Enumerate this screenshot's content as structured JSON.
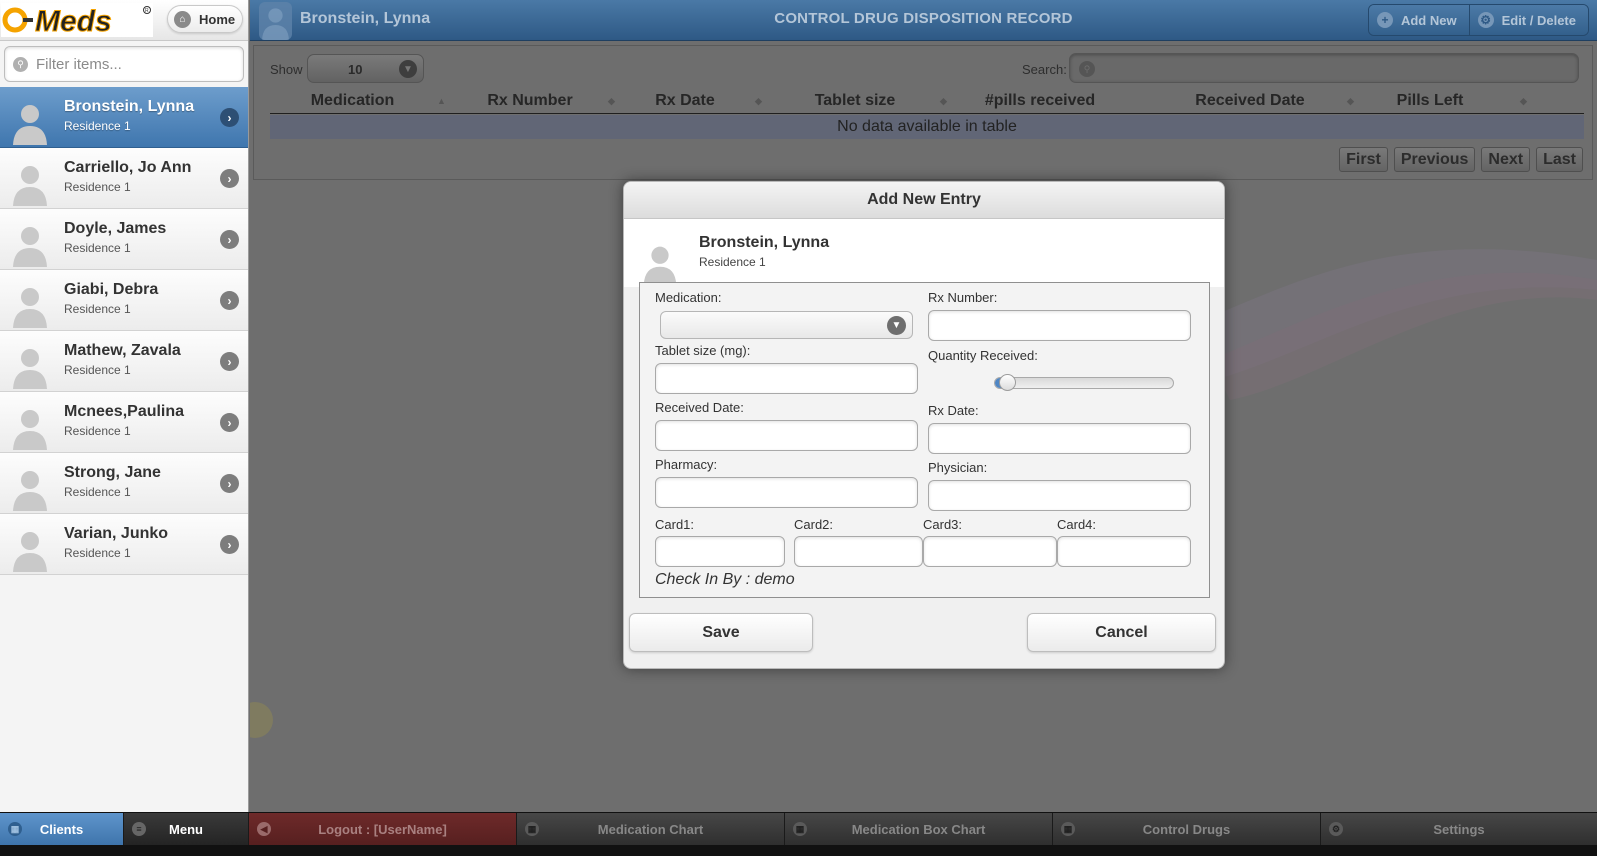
{
  "app": {
    "logo_text": "Q-Meds",
    "home_label": "Home"
  },
  "sidebar": {
    "filter_placeholder": "Filter items...",
    "clients": [
      {
        "name": "Bronstein, Lynna",
        "residence": "Residence 1",
        "active": true
      },
      {
        "name": "Carriello, Jo Ann",
        "residence": "Residence 1"
      },
      {
        "name": "Doyle, James",
        "residence": "Residence 1"
      },
      {
        "name": "Giabi, Debra",
        "residence": "Residence 1"
      },
      {
        "name": "Mathew, Zavala",
        "residence": "Residence 1"
      },
      {
        "name": "Mcnees,Paulina",
        "residence": "Residence 1"
      },
      {
        "name": "Strong, Jane",
        "residence": "Residence 1"
      },
      {
        "name": "Varian, Junko",
        "residence": "Residence 1"
      }
    ]
  },
  "header": {
    "client_name": "Bronstein, Lynna",
    "title": "CONTROL DRUG DISPOSITION RECORD",
    "add_new": "Add New",
    "edit_delete": "Edit / Delete"
  },
  "table": {
    "show_label": "Show",
    "show_value": "10",
    "search_label": "Search:",
    "columns": [
      "Medication",
      "Rx Number",
      "Rx Date",
      "Tablet size",
      "#pills received",
      "Received Date",
      "Pills Left"
    ],
    "empty_text": "No data available in table",
    "pager": [
      "First",
      "Previous",
      "Next",
      "Last"
    ]
  },
  "dialog": {
    "title": "Add New Entry",
    "client_name": "Bronstein, Lynna",
    "client_residence": "Residence 1",
    "labels": {
      "medication": "Medication:",
      "rx_number": "Rx Number:",
      "tablet_size": "Tablet size (mg):",
      "quantity_received": "Quantity Received:",
      "received_date": "Received Date:",
      "rx_date": "Rx Date:",
      "pharmacy": "Pharmacy:",
      "physician": "Physician:",
      "card1": "Card1:",
      "card2": "Card2:",
      "card3": "Card3:",
      "card4": "Card4:"
    },
    "quantity_fraction": 0.05,
    "check_in": "Check In By : demo",
    "save": "Save",
    "cancel": "Cancel"
  },
  "bottom_nav": {
    "clients": "Clients",
    "menu": "Menu",
    "logout": "Logout : [UserName]",
    "medication_chart": "Medication Chart",
    "medication_box_chart": "Medication Box Chart",
    "control_drugs": "Control Drugs",
    "settings": "Settings"
  },
  "colors": {
    "accent_blue": "#3f76ae",
    "header_blue": "#2e5985",
    "logout_red": "#561f1f",
    "logo_orange": "#f5a300"
  }
}
